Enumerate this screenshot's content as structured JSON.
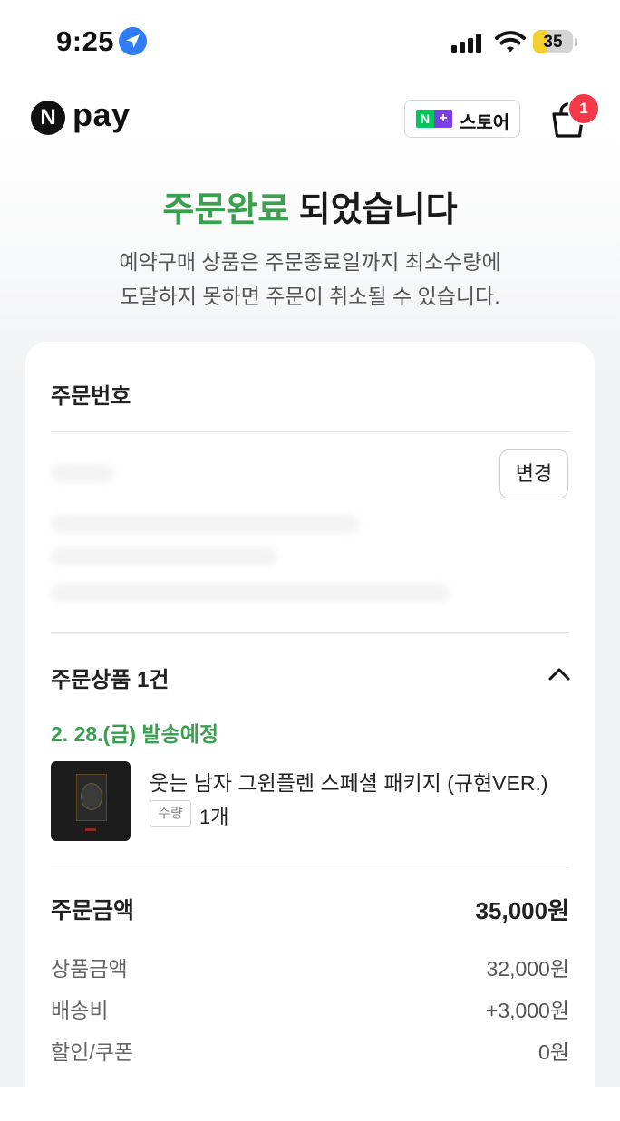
{
  "status_bar": {
    "time": "9:25",
    "battery": "35",
    "battery_level": 0.35
  },
  "header": {
    "logo_n": "N",
    "logo_pay": "pay",
    "store_button": {
      "logo_n": "N",
      "logo_plus": "+",
      "label": "스토어"
    },
    "cart_badge": "1"
  },
  "headline": {
    "highlight": "주문완료",
    "rest": " 되었습니다"
  },
  "notice": {
    "line1": "예약구매 상품은 주문종료일까지 최소수량에",
    "line2": "도달하지 못하면 주문이 취소될 수 있습니다."
  },
  "order": {
    "order_number_label": "주문번호",
    "change_button": "변경",
    "items_header": "주문상품 1건",
    "ship_date": "2. 28.(금) 발송예정",
    "product": {
      "name": "웃는 남자 그윈플렌 스페셜 패키지 (규현VER.)",
      "qty_label": "수량",
      "qty_value": "1개"
    },
    "summary": {
      "total_label": "주문금액",
      "total_value": "35,000원",
      "rows": [
        {
          "label": "상품금액",
          "value": "32,000원"
        },
        {
          "label": "배송비",
          "value": "+3,000원"
        },
        {
          "label": "할인/쿠폰",
          "value": "0원"
        }
      ]
    }
  },
  "colors": {
    "accent_green": "#3aa050",
    "badge_red": "#f4394b",
    "location_blue": "#2f7cf6",
    "battery_yellow": "#f5cf2a"
  }
}
